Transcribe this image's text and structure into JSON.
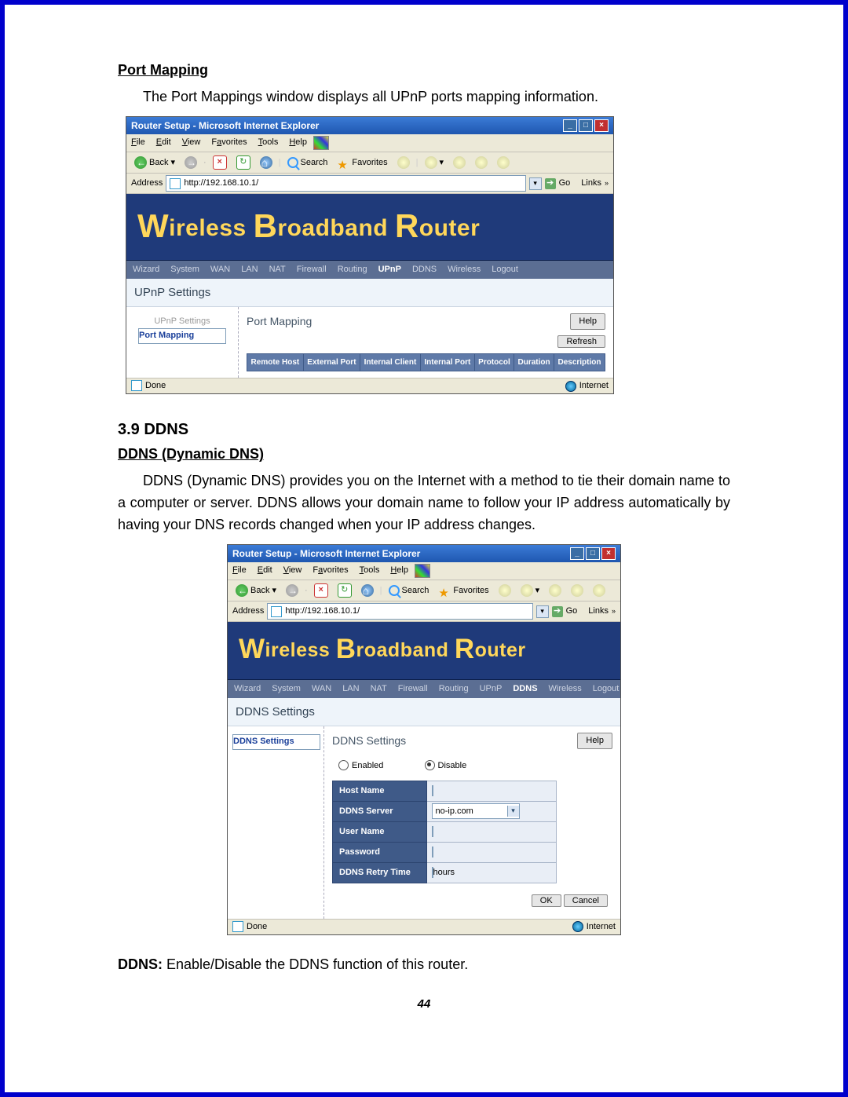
{
  "doc": {
    "port_mapping_heading": "Port Mapping",
    "port_mapping_text": "The Port Mappings window displays all UPnP ports mapping information.",
    "section_num": "3.9   DDNS",
    "ddns_sub": "DDNS (Dynamic DNS)",
    "ddns_para": "DDNS (Dynamic DNS) provides you on the Internet with a method to tie their domain name to a computer or server. DDNS allows your domain name to follow your IP address automatically by having your DNS records changed when your IP address changes.",
    "ddns_foot": "DDNS: Enable/Disable the DDNS function of this router.",
    "page_num": "44"
  },
  "ie": {
    "title": "Router Setup - Microsoft Internet Explorer",
    "menus": [
      "File",
      "Edit",
      "View",
      "Favorites",
      "Tools",
      "Help"
    ],
    "back": "Back",
    "search": "Search",
    "favorites": "Favorites",
    "address_lbl": "Address",
    "address_url": "http://192.168.10.1/",
    "go": "Go",
    "links": "Links",
    "status_done": "Done",
    "status_zone": "Internet"
  },
  "router": {
    "banner_w": "W",
    "banner_ireless": "ireless ",
    "banner_b": "B",
    "banner_roadband": "roadband ",
    "banner_r": "R",
    "banner_outer": "outer",
    "nav": [
      "Wizard",
      "System",
      "WAN",
      "LAN",
      "NAT",
      "Firewall",
      "Routing",
      "UPnP",
      "DDNS",
      "Wireless",
      "Logout"
    ]
  },
  "upnp": {
    "section_title": "UPnP Settings",
    "side_dim": "UPnP Settings",
    "side_sel": "Port Mapping",
    "main_label": "Port Mapping",
    "help": "Help",
    "refresh": "Refresh",
    "cols": [
      "Remote Host",
      "External Port",
      "Internal Client",
      "Internal Port",
      "Protocol",
      "Duration",
      "Description"
    ]
  },
  "ddns": {
    "section_title": "DDNS Settings",
    "side_sel": "DDNS Settings",
    "main_label": "DDNS Settings",
    "help": "Help",
    "opt_enabled": "Enabled",
    "opt_disable": "Disable",
    "f_host": "Host Name",
    "f_server": "DDNS Server",
    "server_val": "no-ip.com",
    "f_user": "User Name",
    "f_pass": "Password",
    "f_retry": "DDNS Retry Time",
    "retry_unit": "hours",
    "ok": "OK",
    "cancel": "Cancel"
  }
}
